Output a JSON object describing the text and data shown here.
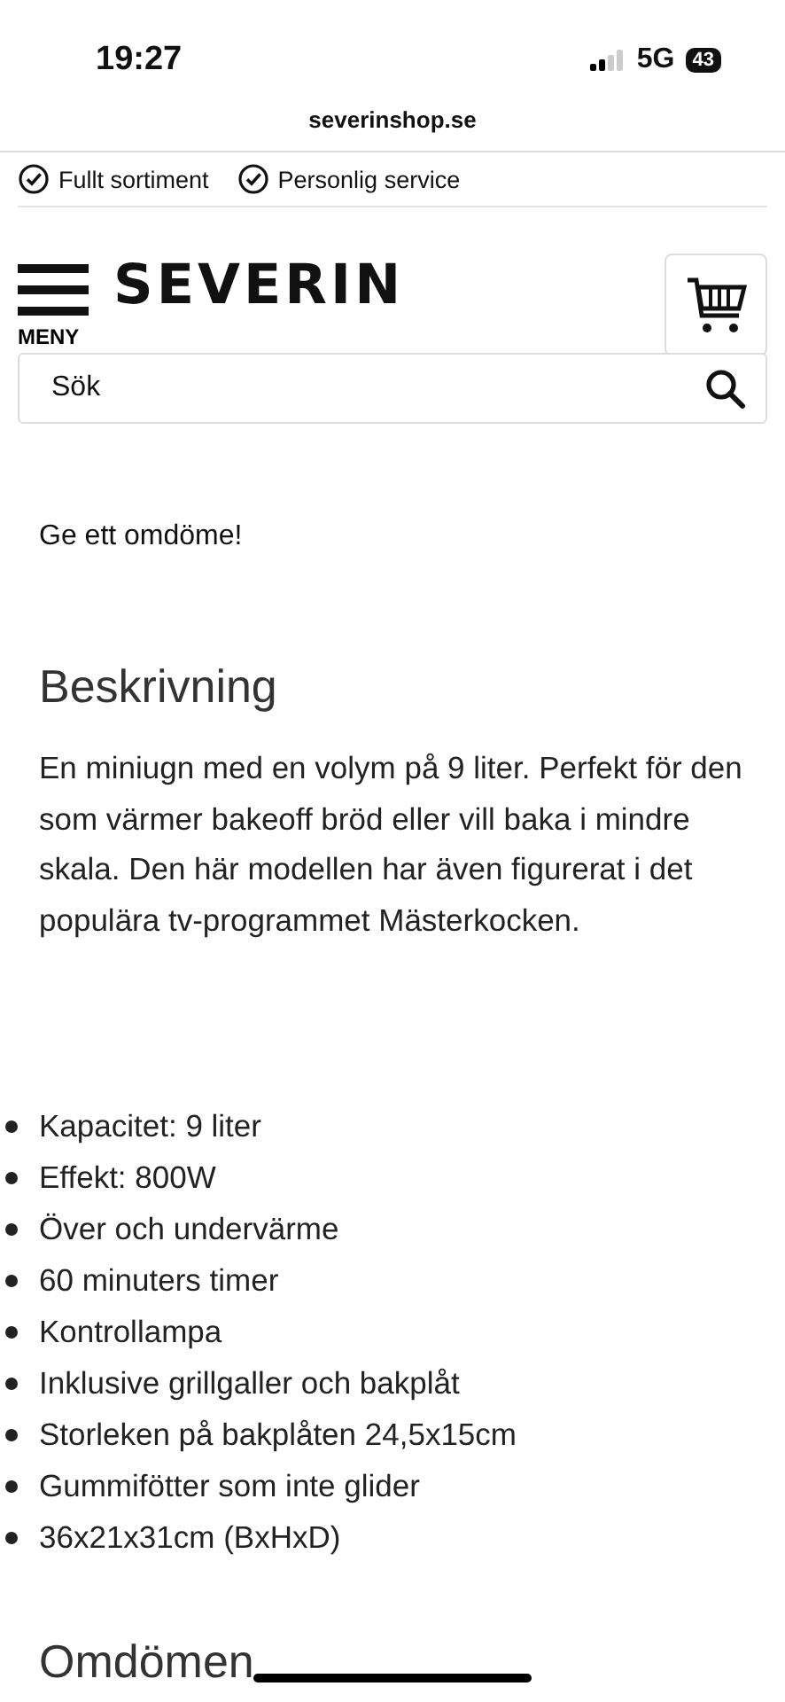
{
  "status_bar": {
    "time": "19:27",
    "network": "5G",
    "battery": "43"
  },
  "address_bar": {
    "url": "severinshop.se"
  },
  "usps": [
    "Fullt sortiment",
    "Personlig service"
  ],
  "header": {
    "menu_label": "MENY",
    "logo": "SEVERIN"
  },
  "search": {
    "placeholder": "Sök"
  },
  "review_link": "Ge ett omdöme!",
  "description": {
    "heading": "Beskrivning",
    "text": "En miniugn med en volym på 9 liter. Perfekt för den som värmer bakeoff bröd eller vill baka i mindre skala. Den här modellen har även figurerat i det populära tv-programmet Mästerkocken."
  },
  "features": [
    "Kapacitet: 9 liter",
    "Effekt: 800W",
    "Över och undervärme",
    "60 minuters timer",
    "Kontrollampa",
    "Inklusive grillgaller och bakplåt",
    "Storleken på bakplåten 24,5x15cm",
    "Gummifötter som inte glider",
    "36x21x31cm (BxHxD)"
  ],
  "reviews_heading": "Omdömen"
}
